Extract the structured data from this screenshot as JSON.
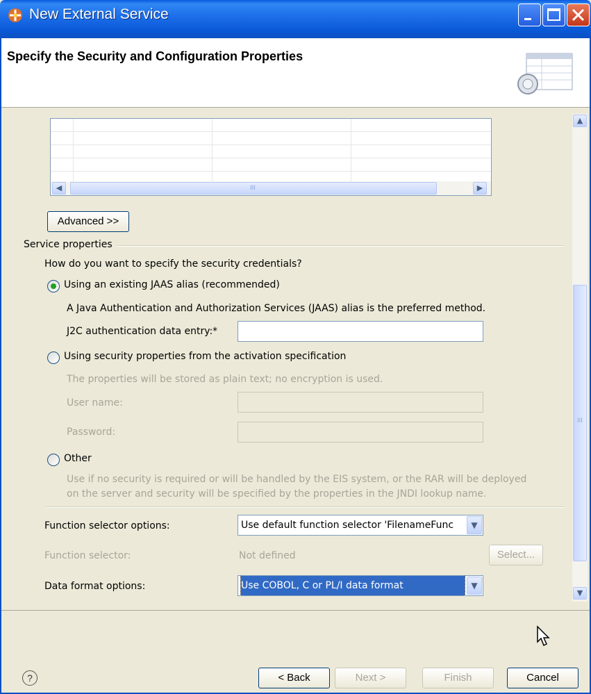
{
  "window": {
    "title": "New External Service"
  },
  "header": {
    "title": "Specify the Security and Configuration Properties"
  },
  "table": {
    "scroll_thumb_grip": "III"
  },
  "advanced_button": "Advanced >>",
  "service_properties": {
    "group_label": "Service properties",
    "question": "How do you want to specify the security credentials?",
    "option_jaas": {
      "label": "Using an existing JAAS alias (recommended)",
      "selected": true,
      "description": "A Java Authentication and Authorization Services (JAAS) alias is the preferred method.",
      "field_label": "J2C authentication data entry:*",
      "field_value": ""
    },
    "option_activation": {
      "label": "Using security properties from the activation specification",
      "selected": false,
      "description": "The properties will be stored as plain text; no encryption is used.",
      "user_label": "User name:",
      "user_value": "",
      "password_label": "Password:",
      "password_value": ""
    },
    "option_other": {
      "label": "Other",
      "selected": false,
      "description_line1": "Use if no security is required or will be handled by the EIS system, or the RAR will be deployed",
      "description_line2": "on the server and security will be specified by the properties in the JNDI lookup name."
    }
  },
  "function_selector_options": {
    "label": "Function selector options:",
    "value": "Use default function selector 'FilenameFunc"
  },
  "function_selector": {
    "label": "Function selector:",
    "value": "Not defined",
    "select_button": "Select..."
  },
  "data_format_options": {
    "label": "Data format options:",
    "value": "Use COBOL, C or PL/I data format"
  },
  "footer": {
    "help": "?",
    "back": "< Back",
    "next": "Next >",
    "finish": "Finish",
    "cancel": "Cancel"
  },
  "colors": {
    "titlebar": "#0a58d6",
    "dialog_bg": "#ece9d8",
    "selection": "#316ac5",
    "radio_dot": "#21a121"
  }
}
